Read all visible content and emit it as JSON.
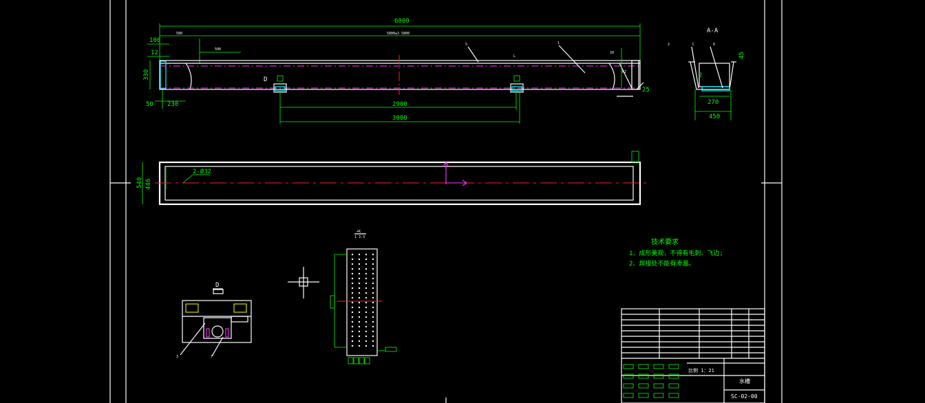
{
  "drawing": {
    "dims_main": [
      "6000",
      "100",
      "12",
      "330",
      "50",
      "230",
      "2900",
      "3000",
      "25",
      "45",
      "270",
      "450",
      "446",
      "540"
    ],
    "tiny_main": [
      "500",
      "5800±3 5800",
      "500",
      "20",
      "R2"
    ],
    "section_label": "A-A",
    "hole_label": "2-Ø32",
    "detail_label": "D",
    "scale_label_a": "1 3.3",
    "tech_title": "技术要求",
    "tech_items": [
      "1、成形美观，不得有毛刺、飞边;",
      "2、焊接处不能有渗漏。"
    ],
    "title_block": {
      "name": "水槽",
      "code": "SC-02-00",
      "scale": "比例 1：21"
    }
  },
  "colors": {
    "background": "#000000",
    "outline": "#ffffff",
    "dimension": "#00ff00",
    "center": "#ff2020",
    "hidden": "#ff33ff",
    "cyan": "#00ffff"
  }
}
